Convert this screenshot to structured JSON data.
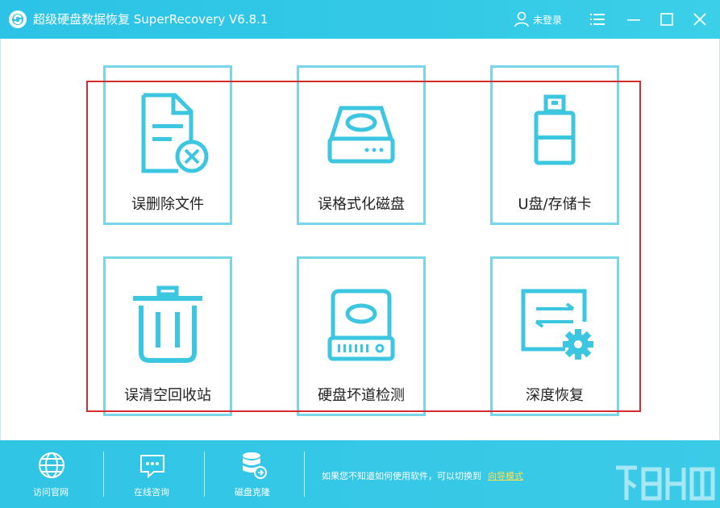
{
  "titlebar": {
    "title": "超级硬盘数据恢复 SuperRecovery V6.8.1",
    "user_label": "未登录"
  },
  "cards": [
    {
      "label": "误删除文件",
      "icon": "deleted-file-icon"
    },
    {
      "label": "误格式化磁盘",
      "icon": "disk-icon"
    },
    {
      "label": "U盘/存储卡",
      "icon": "usb-drive-icon"
    },
    {
      "label": "误清空回收站",
      "icon": "trash-icon"
    },
    {
      "label": "硬盘坏道检测",
      "icon": "hard-drive-scan-icon"
    },
    {
      "label": "深度恢复",
      "icon": "deep-recovery-icon"
    }
  ],
  "bottombar": {
    "tools": [
      {
        "label": "访问官网",
        "icon": "globe-icon"
      },
      {
        "label": "在线咨询",
        "icon": "chat-icon"
      },
      {
        "label": "磁盘克隆",
        "icon": "database-clone-icon"
      }
    ],
    "hint_text": "如果您不知道如何使用软件，可以切换到",
    "guide_link": "向导模式"
  },
  "colors": {
    "titlebar": "#2cc3e6",
    "accent": "#3cc6e0",
    "card_border": "#7ad6e6",
    "highlight": "#d42d2d",
    "link": "#ffe24a"
  }
}
